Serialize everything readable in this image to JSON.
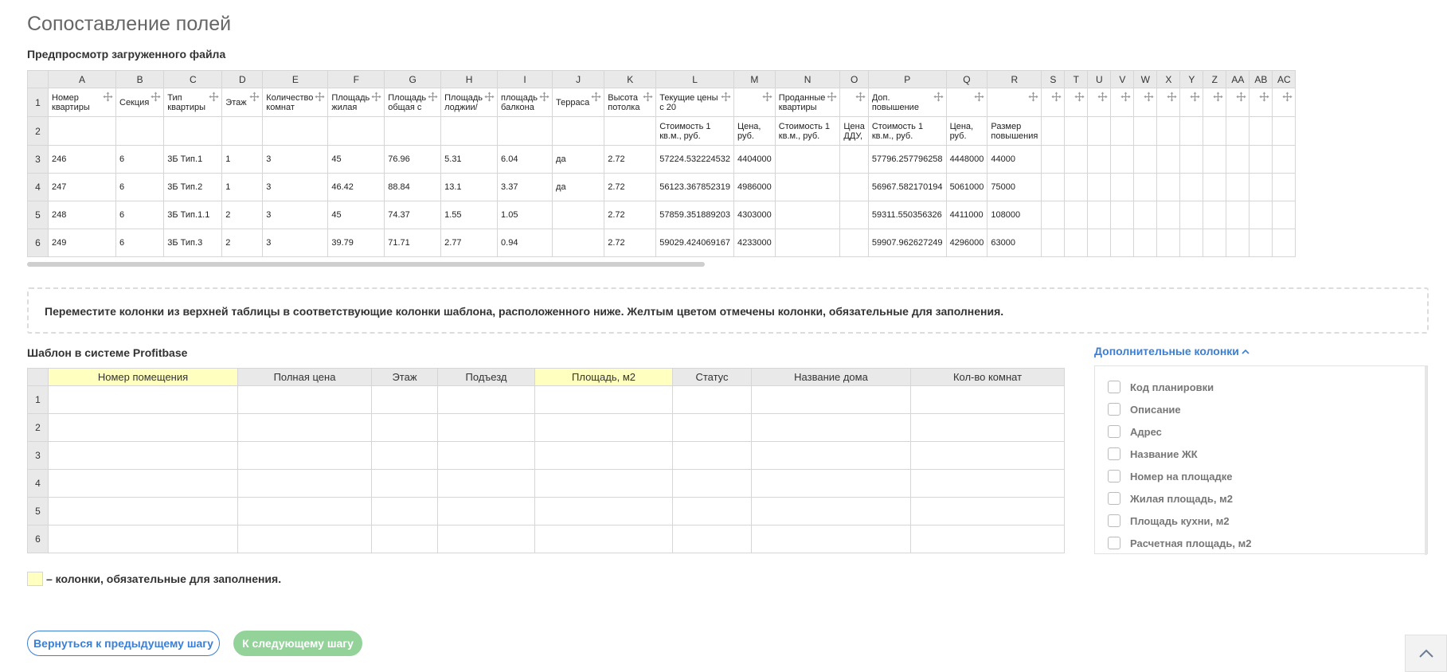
{
  "page": {
    "title": "Сопоставление полей",
    "preview_title": "Предпросмотр загруженного файла",
    "template_title": "Шаблон в системе Profitbase",
    "instruction": "Переместите колонки из верхней таблицы в соответствующие колонки шаблона, расположенного ниже. Желтым цветом отмечены колонки, обязательные для заполнения.",
    "legend_text": "– колонки, обязательные для заполнения.",
    "legend_color": "#ffffbf"
  },
  "preview": {
    "columns": [
      "A",
      "B",
      "C",
      "D",
      "E",
      "F",
      "G",
      "H",
      "I",
      "J",
      "K",
      "L",
      "M",
      "N",
      "O",
      "P",
      "Q",
      "R",
      "S",
      "T",
      "U",
      "V",
      "W",
      "X",
      "Y",
      "Z",
      "AA",
      "AB",
      "AC"
    ],
    "header_row": [
      "Номер квартиры",
      "Секция",
      "Тип квартиры",
      "Этаж",
      "Количество комнат",
      "Площадь жилая",
      "Площадь общая с",
      "Площадь лоджии/",
      "площадь балкона",
      "Терраса",
      "Высота потолка",
      "Текущие цены с 20",
      "",
      "Проданные квартиры",
      "",
      "Доп. повышение",
      "",
      "",
      "",
      "",
      "",
      "",
      "",
      "",
      "",
      "",
      "",
      "",
      ""
    ],
    "sub_row": [
      "",
      "",
      "",
      "",
      "",
      "",
      "",
      "",
      "",
      "",
      "",
      "Стоимость 1 кв.м., руб.",
      "Цена, руб.",
      "Стоимость 1 кв.м., руб.",
      "Цена ДДУ,",
      "Стоимость 1 кв.м., руб.",
      "Цена, руб.",
      "Размер повышения",
      "",
      "",
      "",
      "",
      "",
      "",
      "",
      "",
      "",
      "",
      ""
    ],
    "rows": [
      [
        "246",
        "6",
        "3Б Тип.1",
        "1",
        "3",
        "45",
        "76.96",
        "5.31",
        "6.04",
        "да",
        "2.72",
        "57224.532224532",
        "4404000",
        "",
        "",
        "57796.257796258",
        "4448000",
        "44000",
        "",
        "",
        "",
        "",
        "",
        "",
        "",
        "",
        "",
        "",
        ""
      ],
      [
        "247",
        "6",
        "3Б Тип.2",
        "1",
        "3",
        "46.42",
        "88.84",
        "13.1",
        "3.37",
        "да",
        "2.72",
        "56123.367852319",
        "4986000",
        "",
        "",
        "56967.582170194",
        "5061000",
        "75000",
        "",
        "",
        "",
        "",
        "",
        "",
        "",
        "",
        "",
        "",
        ""
      ],
      [
        "248",
        "6",
        "3Б Тип.1.1",
        "2",
        "3",
        "45",
        "74.37",
        "1.55",
        "1.05",
        "",
        "2.72",
        "57859.351889203",
        "4303000",
        "",
        "",
        "59311.550356326",
        "4411000",
        "108000",
        "",
        "",
        "",
        "",
        "",
        "",
        "",
        "",
        "",
        "",
        ""
      ],
      [
        "249",
        "6",
        "3Б Тип.3",
        "2",
        "3",
        "39.79",
        "71.71",
        "2.77",
        "0.94",
        "",
        "2.72",
        "59029.424069167",
        "4233000",
        "",
        "",
        "59907.962627249",
        "4296000",
        "63000",
        "",
        "",
        "",
        "",
        "",
        "",
        "",
        "",
        "",
        "",
        ""
      ]
    ]
  },
  "template": {
    "columns": [
      {
        "label": "Номер помещения",
        "required": true
      },
      {
        "label": "Полная цена",
        "required": false
      },
      {
        "label": "Этаж",
        "required": false
      },
      {
        "label": "Подъезд",
        "required": false
      },
      {
        "label": "Площадь, м2",
        "required": true
      },
      {
        "label": "Статус",
        "required": false
      },
      {
        "label": "Название дома",
        "required": false
      },
      {
        "label": "Кол-во комнат",
        "required": false
      }
    ],
    "row_numbers": [
      "1",
      "2",
      "3",
      "4",
      "5",
      "6"
    ]
  },
  "extra": {
    "toggle_label": "Дополнительные колонки",
    "items": [
      "Код планировки",
      "Описание",
      "Адрес",
      "Название ЖК",
      "Номер на площадке",
      "Жилая площадь, м2",
      "Площадь кухни, м2",
      "Расчетная площадь, м2"
    ]
  },
  "buttons": {
    "back": "Вернуться к предыдущему шагу",
    "next": "К следующему шагу"
  },
  "colors": {
    "accent": "#3a7fd5",
    "next_button": "#93d39a",
    "required_column": "#ffffbf",
    "header_gray": "#e9e9e9"
  }
}
